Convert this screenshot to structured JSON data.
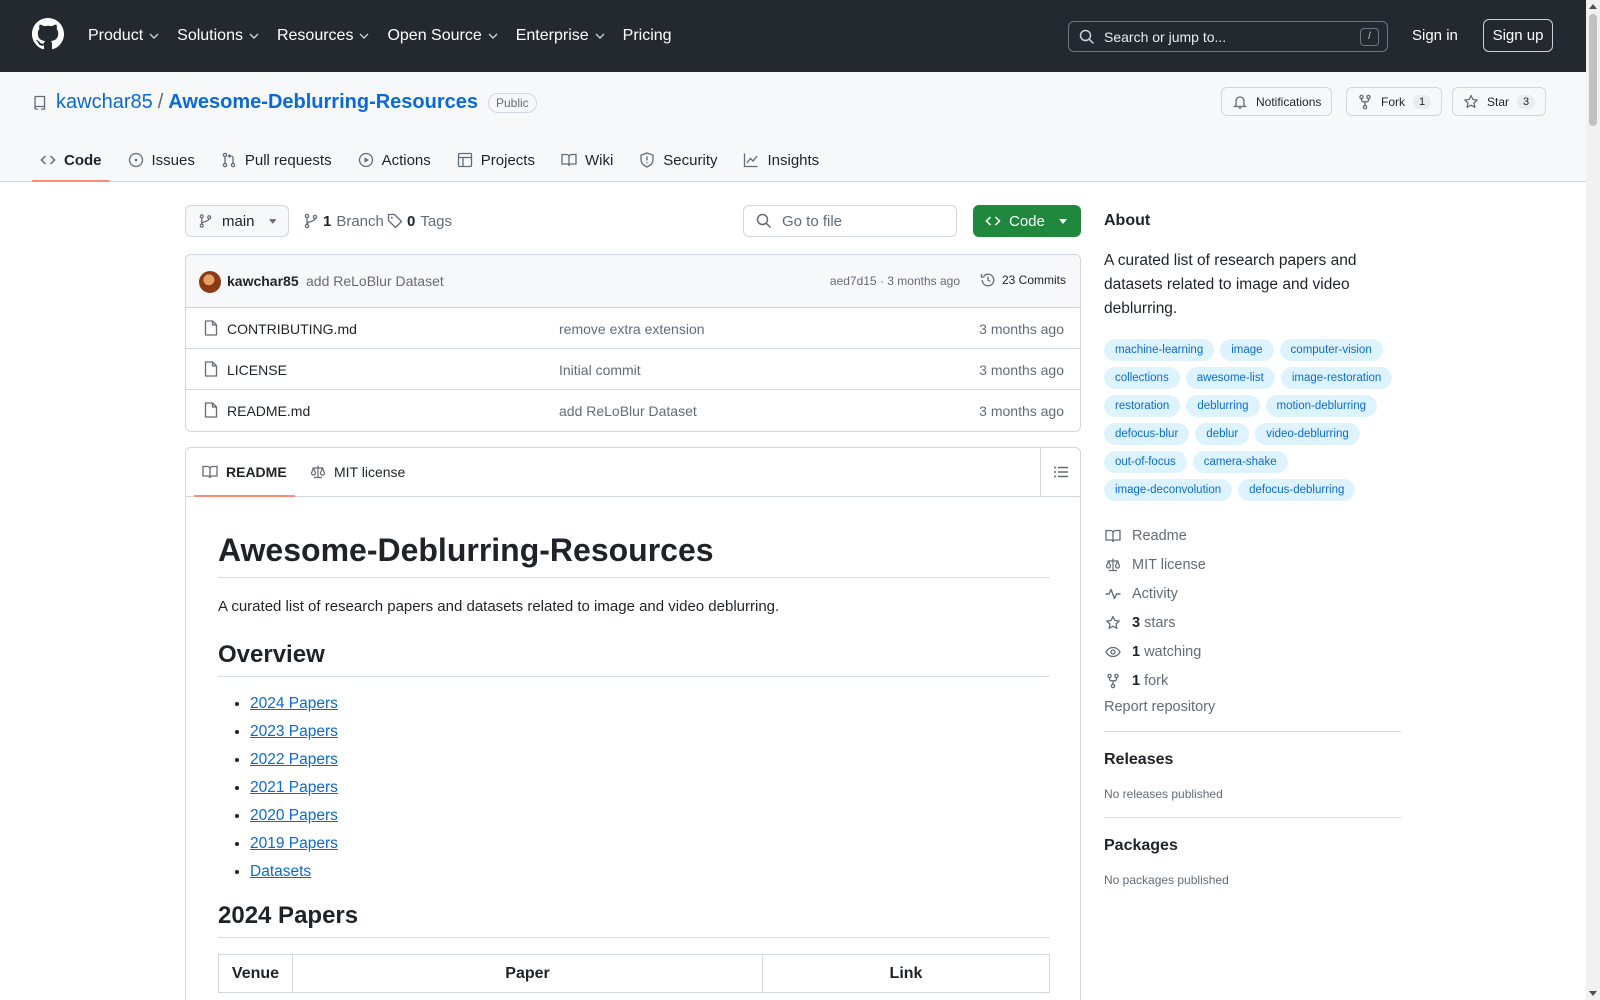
{
  "header": {
    "nav": [
      "Product",
      "Solutions",
      "Resources",
      "Open Source",
      "Enterprise",
      "Pricing"
    ],
    "search_placeholder": "Search or jump to...",
    "search_shortcut": "/",
    "sign_in": "Sign in",
    "sign_up": "Sign up"
  },
  "repo": {
    "owner": "kawchar85",
    "separator": "/",
    "name": "Awesome-Deblurring-Resources",
    "visibility": "Public",
    "notifications": "Notifications",
    "fork_label": "Fork",
    "fork_count": "1",
    "star_label": "Star",
    "star_count": "3"
  },
  "tabs": [
    "Code",
    "Issues",
    "Pull requests",
    "Actions",
    "Projects",
    "Wiki",
    "Security",
    "Insights"
  ],
  "toolbar": {
    "branch": "main",
    "branch_count": "1",
    "branch_label": "Branch",
    "tag_count": "0",
    "tag_label": "Tags",
    "goto_file": "Go to file",
    "code_button": "Code"
  },
  "commit": {
    "author": "kawchar85",
    "message": "add ReLoBlur Dataset",
    "meta": "aed7d15 · 3 months ago",
    "commits": "23 Commits"
  },
  "files": [
    {
      "name": "CONTRIBUTING.md",
      "message": "remove extra extension",
      "age": "3 months ago"
    },
    {
      "name": "LICENSE",
      "message": "Initial commit",
      "age": "3 months ago"
    },
    {
      "name": "README.md",
      "message": "add ReLoBlur Dataset",
      "age": "3 months ago"
    }
  ],
  "readme": {
    "tab_readme": "README",
    "tab_license": "MIT license",
    "h1": "Awesome-Deblurring-Resources",
    "intro": "A curated list of research papers and datasets related to image and video deblurring.",
    "overview_heading": "Overview",
    "overview_links": [
      "2024 Papers",
      "2023 Papers",
      "2022 Papers",
      "2021 Papers",
      "2020 Papers",
      "2019 Papers",
      "Datasets"
    ],
    "section_heading": "2024 Papers",
    "table_headers": [
      "Venue",
      "Paper",
      "Link"
    ]
  },
  "sidebar": {
    "about_heading": "About",
    "description": "A curated list of research papers and datasets related to image and video deblurring.",
    "topics": [
      "machine-learning",
      "image",
      "computer-vision",
      "collections",
      "awesome-list",
      "image-restoration",
      "restoration",
      "deblurring",
      "motion-deblurring",
      "defocus-blur",
      "deblur",
      "video-deblurring",
      "out-of-focus",
      "camera-shake",
      "image-deconvolution",
      "defocus-deblurring"
    ],
    "readme_link": "Readme",
    "license_link": "MIT license",
    "activity_link": "Activity",
    "stars_count": "3",
    "stars_label": "stars",
    "watching_count": "1",
    "watching_label": "watching",
    "fork_count": "1",
    "fork_label": "fork",
    "report": "Report repository",
    "releases_heading": "Releases",
    "releases_none": "No releases published",
    "packages_heading": "Packages",
    "packages_none": "No packages published"
  },
  "colors": {
    "header_bg": "#24292f",
    "link": "#0969da",
    "green_button": "#1f883d",
    "tab_underline": "#fd8c73",
    "topic_bg": "#ddf4ff"
  }
}
